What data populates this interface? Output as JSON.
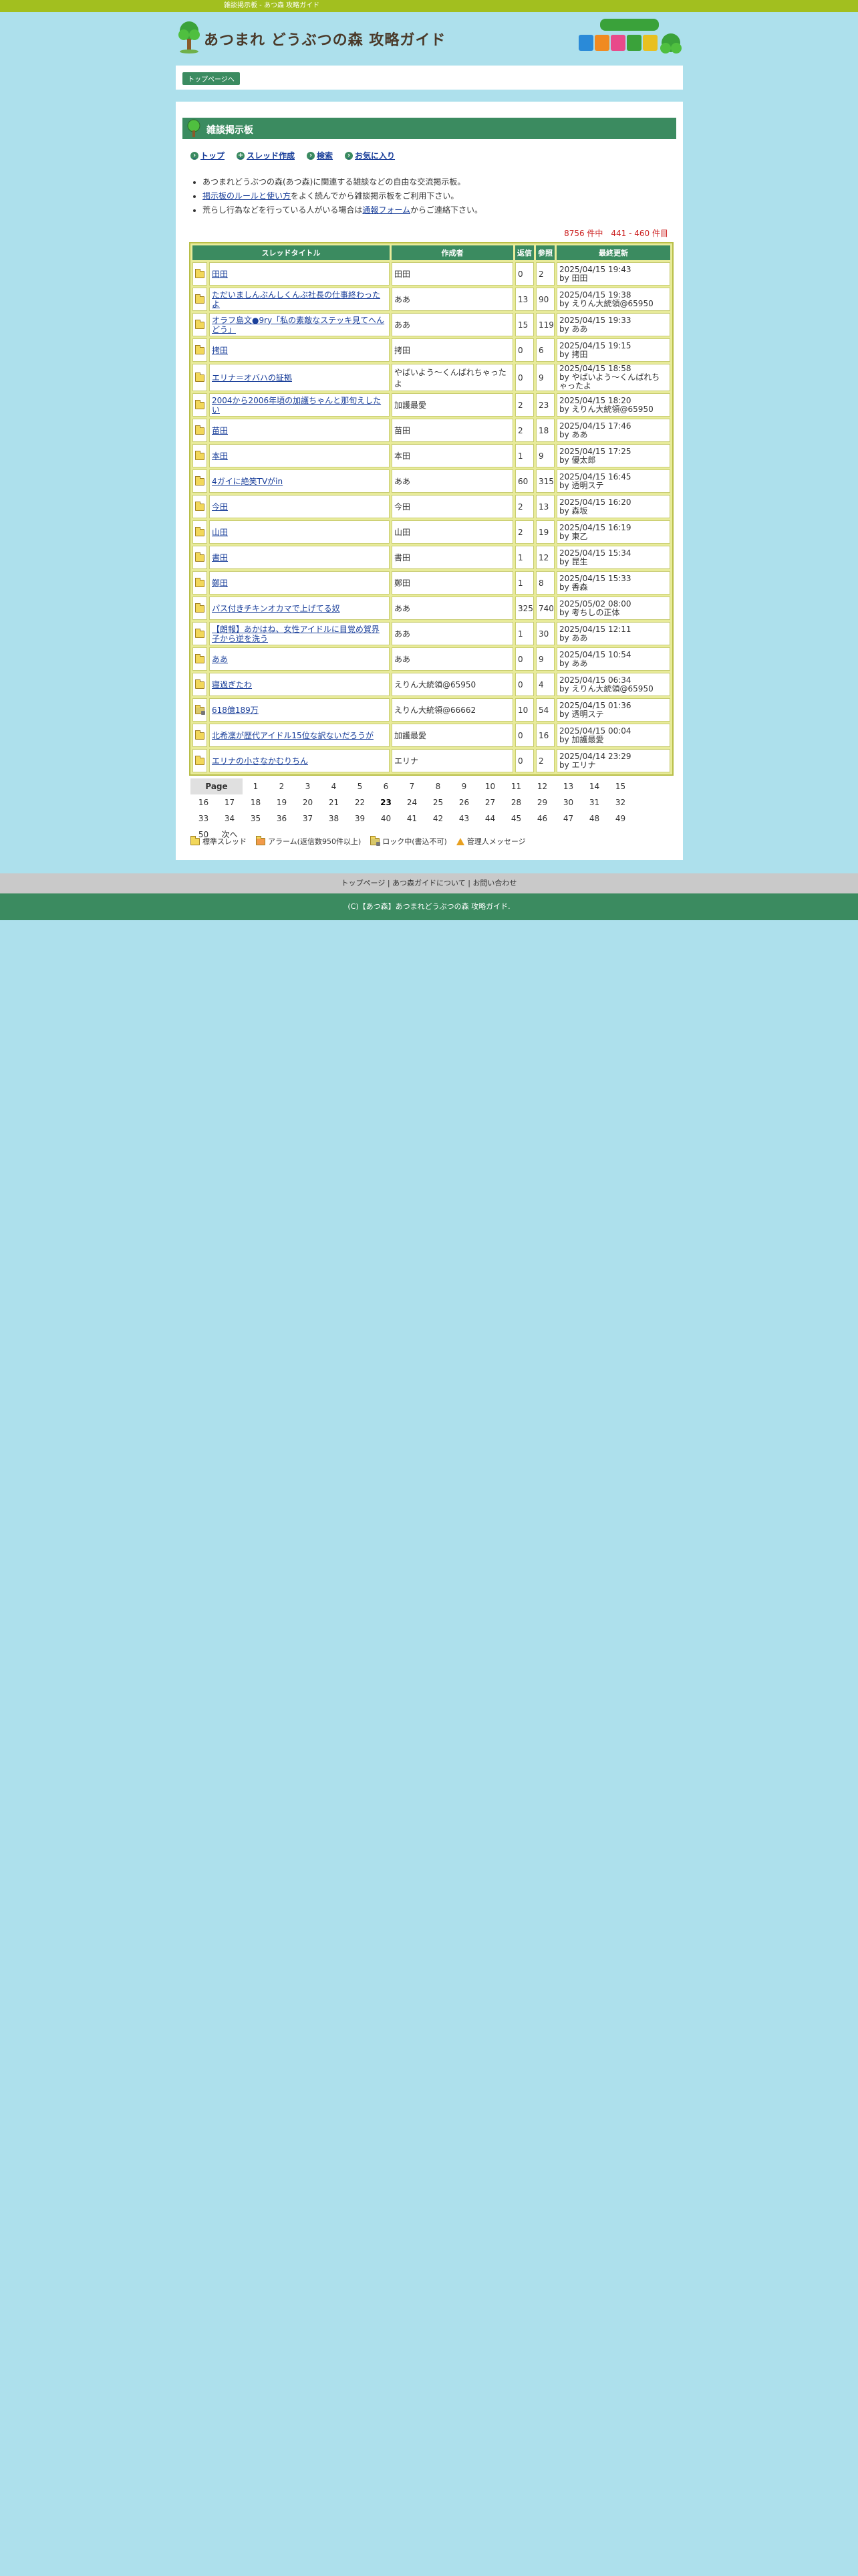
{
  "topbar": {
    "text": "雑談掲示板 - あつ森 攻略ガイド"
  },
  "header": {
    "site_title": "あつまれ どうぶつの森 攻略ガイド"
  },
  "crumb": {
    "top_label": "トップページへ"
  },
  "board": {
    "title": "雑談掲示板",
    "actions": {
      "top": "トップ",
      "create": "スレッド作成",
      "search": "検索",
      "favorites": "お気に入り"
    },
    "notes": {
      "n1": "あつまれどうぶつの森(あつ森)に関連する雑談などの自由な交流掲示板。",
      "n2_link": "掲示板のルールと使い方",
      "n2_rest": "をよく読んでから雑談掲示板をご利用下さい。",
      "n3_pre": "荒らし行為などを行っている人がいる場合は",
      "n3_link": "通報フォーム",
      "n3_post": "からご連絡下さい。"
    },
    "count": "8756 件中　441 - 460 件目"
  },
  "table": {
    "headers": {
      "title": "スレッドタイトル",
      "author": "作成者",
      "replies": "返信",
      "views": "参照",
      "updated": "最終更新"
    },
    "rows": [
      {
        "title": "田田",
        "author": "田田",
        "replies": "0",
        "views": "2",
        "date": "2025/04/15 19:43",
        "by": "by 田田",
        "locked": false
      },
      {
        "title": "ただいましんぶんしくんぶ社長の仕事終わったよ",
        "author": "ああ",
        "replies": "13",
        "views": "90",
        "date": "2025/04/15 19:38",
        "by": "by えりん大統領@65950",
        "locked": false
      },
      {
        "title": "オラフ島文●9ry「私の素敵なステッキ見てへんどう」",
        "author": "ああ",
        "replies": "15",
        "views": "119",
        "date": "2025/04/15 19:33",
        "by": "by ああ",
        "locked": false
      },
      {
        "title": "拷田",
        "author": "拷田",
        "replies": "0",
        "views": "6",
        "date": "2025/04/15 19:15",
        "by": "by 拷田",
        "locked": false
      },
      {
        "title": "エリナ＝オバハの証拠",
        "author": "やばいよう～くんばれちゃったよ",
        "replies": "0",
        "views": "9",
        "date": "2025/04/15 18:58",
        "by": "by やばいよう～くんばれちゃったよ",
        "locked": false
      },
      {
        "title": "2004から2006年頃の加護ちゃんと那旬えしたい",
        "author": "加護最愛",
        "replies": "2",
        "views": "23",
        "date": "2025/04/15 18:20",
        "by": "by えりん大統領@65950",
        "locked": false
      },
      {
        "title": "苗田",
        "author": "苗田",
        "replies": "2",
        "views": "18",
        "date": "2025/04/15 17:46",
        "by": "by ああ",
        "locked": false
      },
      {
        "title": "本田",
        "author": "本田",
        "replies": "1",
        "views": "9",
        "date": "2025/04/15 17:25",
        "by": "by 優太郎",
        "locked": false
      },
      {
        "title": "4ガイに絶笑TVがin",
        "author": "ああ",
        "replies": "60",
        "views": "315",
        "date": "2025/04/15 16:45",
        "by": "by 透明ステ",
        "locked": false
      },
      {
        "title": "今田",
        "author": "今田",
        "replies": "2",
        "views": "13",
        "date": "2025/04/15 16:20",
        "by": "by 森坂",
        "locked": false
      },
      {
        "title": "山田",
        "author": "山田",
        "replies": "2",
        "views": "19",
        "date": "2025/04/15 16:19",
        "by": "by 東乙",
        "locked": false
      },
      {
        "title": "書田",
        "author": "書田",
        "replies": "1",
        "views": "12",
        "date": "2025/04/15 15:34",
        "by": "by 昆生",
        "locked": false
      },
      {
        "title": "鄭田",
        "author": "鄭田",
        "replies": "1",
        "views": "8",
        "date": "2025/04/15 15:33",
        "by": "by 香森",
        "locked": false
      },
      {
        "title": "パス付きチキンオカマで上げてる奴",
        "author": "ああ",
        "replies": "325",
        "views": "740",
        "date": "2025/05/02 08:00",
        "by": "by 考ちしの正体",
        "locked": false
      },
      {
        "title": "【朗報】あかはね、女性アイドルに目覚め賀界子から逆を洗う",
        "author": "ああ",
        "replies": "1",
        "views": "30",
        "date": "2025/04/15 12:11",
        "by": "by ああ",
        "locked": false
      },
      {
        "title": "ああ",
        "author": "ああ",
        "replies": "0",
        "views": "9",
        "date": "2025/04/15 10:54",
        "by": "by ああ",
        "locked": false
      },
      {
        "title": "寝過ぎたわ",
        "author": "えりん大統領@65950",
        "replies": "0",
        "views": "4",
        "date": "2025/04/15 06:34",
        "by": "by えりん大統領@65950",
        "locked": false
      },
      {
        "title": "618億189万",
        "author": "えりん大統領@66662",
        "replies": "10",
        "views": "54",
        "date": "2025/04/15 01:36",
        "by": "by 透明ステ",
        "locked": true
      },
      {
        "title": "北希凜が歴代アイドル15位な訳ないだろうが",
        "author": "加護最愛",
        "replies": "0",
        "views": "16",
        "date": "2025/04/15 00:04",
        "by": "by 加護最愛",
        "locked": false
      },
      {
        "title": "エリナの小さなかむりちん",
        "author": "エリナ",
        "replies": "0",
        "views": "2",
        "date": "2025/04/14 23:29",
        "by": "by エリナ",
        "locked": false
      }
    ]
  },
  "pager": {
    "label": "Page",
    "current": "23",
    "pages": [
      "1",
      "2",
      "3",
      "4",
      "5",
      "6",
      "7",
      "8",
      "9",
      "10",
      "11",
      "12",
      "13",
      "14",
      "15",
      "16",
      "17",
      "18",
      "19",
      "20",
      "21",
      "22",
      "23",
      "24",
      "25",
      "26",
      "27",
      "28",
      "29",
      "30",
      "31",
      "32",
      "33",
      "34",
      "35",
      "36",
      "37",
      "38",
      "39",
      "40",
      "41",
      "42",
      "43",
      "44",
      "45",
      "46",
      "47",
      "48",
      "49",
      "50"
    ],
    "next": "次へ"
  },
  "legend": {
    "normal": "標準スレッド",
    "alarm": "アラーム(返信数950件以上)",
    "locked": "ロック中(書込不可)",
    "admin": "管理人メッセージ"
  },
  "footer": {
    "top": "トップページ",
    "about": "あつ森ガイドについて",
    "contact": "お問い合わせ",
    "sep": "|",
    "copyright": "(C)【あつ森】あつまれどうぶつの森 攻略ガイド."
  },
  "colors": {
    "accent": "#3b8b60",
    "topbar": "#a2bf1f",
    "background": "#ade0ec"
  }
}
